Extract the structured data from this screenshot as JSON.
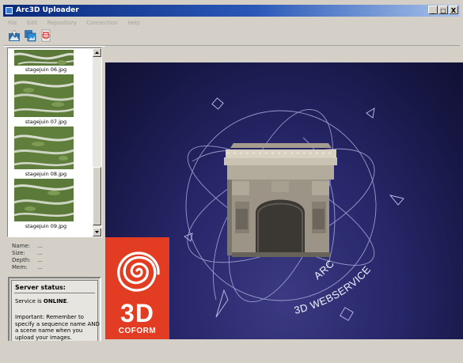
{
  "window": {
    "title": "Arc3D Uploader",
    "buttons": [
      "_",
      "□",
      "X"
    ]
  },
  "menu": [
    "File",
    "Edit",
    "Repository",
    "Connection",
    "Help"
  ],
  "toolbar": {
    "buttons": [
      {
        "name": "upload-icon"
      },
      {
        "name": "images-icon"
      },
      {
        "name": "new-document-icon"
      }
    ]
  },
  "thumbnails": {
    "items": [
      {
        "label": "stagejuin 06.jpg"
      },
      {
        "label": "stagejuin 07.jpg"
      },
      {
        "label": "stagejuin 08.jpg"
      },
      {
        "label": "stagejuin 09.jpg"
      }
    ]
  },
  "info": {
    "name_label": "Name:",
    "name_value": "...",
    "size_label": "Size:",
    "size_value": "...",
    "depth_label": "Depth:",
    "depth_value": "...",
    "mem_label": "Mem:",
    "mem_value": "..."
  },
  "server_status": {
    "title": "Server status:",
    "service_prefix": "Service is",
    "service_state": "ONLINE",
    "service_suffix": ".",
    "note": "Important: Remember to specify a sequence name AND a scene name when you upload your images."
  },
  "render": {
    "arc_text": "ARC",
    "webservice_text": "3D WEBSERVICE"
  },
  "logo": {
    "big": "3D",
    "brand": "COFORM"
  },
  "colors": {
    "logo_red": "#e23d22",
    "background_navy": "#1c1b55"
  }
}
